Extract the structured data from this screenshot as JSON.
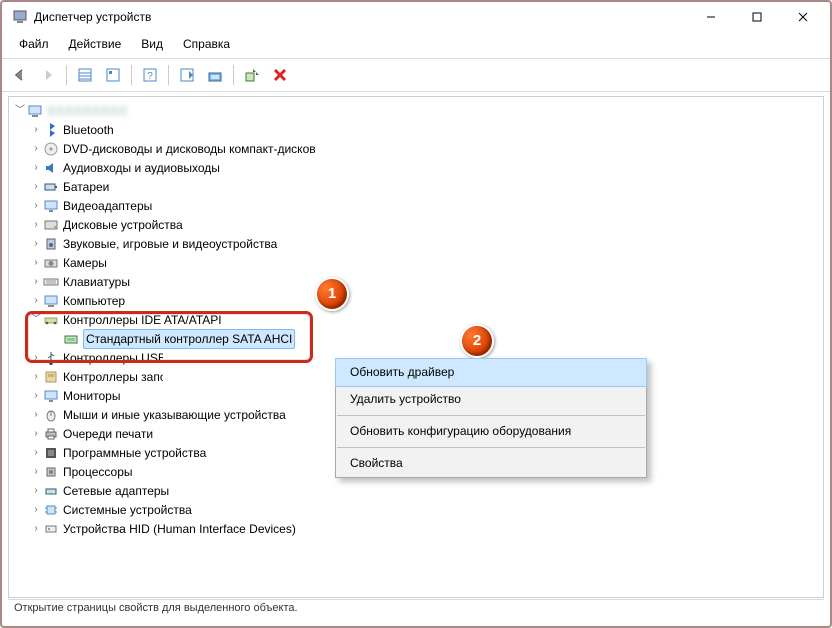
{
  "window": {
    "title": "Диспетчер устройств"
  },
  "menus": {
    "file": "Файл",
    "action": "Действие",
    "view": "Вид",
    "help": "Справка"
  },
  "statusbar": "Открытие страницы свойств для выделенного объекта.",
  "tree": {
    "root": "",
    "items": [
      {
        "label": "Bluetooth",
        "icon": "bluetooth"
      },
      {
        "label": "DVD-дисководы и дисководы компакт-дисков",
        "icon": "disc"
      },
      {
        "label": "Аудиовходы и аудиовыходы",
        "icon": "audio"
      },
      {
        "label": "Батареи",
        "icon": "battery"
      },
      {
        "label": "Видеоадаптеры",
        "icon": "display"
      },
      {
        "label": "Дисковые устройства",
        "icon": "hdd"
      },
      {
        "label": "Звуковые, игровые и видеоустройства",
        "icon": "speaker"
      },
      {
        "label": "Камеры",
        "icon": "camera"
      },
      {
        "label": "Клавиатуры",
        "icon": "keyboard"
      },
      {
        "label": "Компьютер",
        "icon": "pc",
        "cut": true
      }
    ],
    "highlight": {
      "parent": "Контроллеры IDE ATA/ATAPI",
      "child": "Стандартный контроллер SATA AHCI"
    },
    "items2": [
      {
        "label": "Контроллеры USB",
        "icon": "usb",
        "cut": true
      },
      {
        "label": "Контроллеры запоминающих устройств",
        "icon": "storage",
        "cut": true
      },
      {
        "label": "Мониторы",
        "icon": "monitor"
      },
      {
        "label": "Мыши и иные указывающие устройства",
        "icon": "mouse"
      },
      {
        "label": "Очереди печати",
        "icon": "printer"
      },
      {
        "label": "Программные устройства",
        "icon": "soft"
      },
      {
        "label": "Процессоры",
        "icon": "cpu"
      },
      {
        "label": "Сетевые адаптеры",
        "icon": "net"
      },
      {
        "label": "Системные устройства",
        "icon": "chip"
      },
      {
        "label": "Устройства HID (Human Interface Devices)",
        "icon": "hid"
      }
    ]
  },
  "context_menu": {
    "update": "Обновить драйвер",
    "remove": "Удалить устройство",
    "rescan": "Обновить конфигурацию оборудования",
    "props": "Свойства"
  },
  "badges": {
    "one": "1",
    "two": "2"
  }
}
